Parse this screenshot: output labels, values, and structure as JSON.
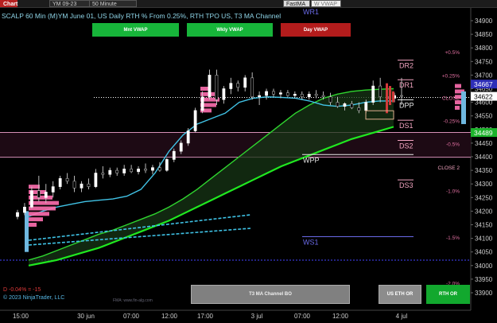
{
  "toolbar": {
    "chart_label": "Chart",
    "symbol": "YM 09-23",
    "interval": "50 Minute",
    "fasma_label": "FastMA",
    "wvwap_label": "W VWAP"
  },
  "title": "SCALP 60 Min (M)YM June 01, US Daily RTH % From 0.25%, RTH TPO US, T3 MA Channel",
  "buttons": {
    "monthly_vwap": "Mnt VWAP",
    "weekly_vwap": "Wkly VWAP",
    "day_vwap": "Day VWAP",
    "t3_channel": "T3 MA Channel BO",
    "us_eth": "US ETH OR",
    "rth_or": "RTH OR"
  },
  "pnl_text": "D -0.04% = -15",
  "copyright": "© 2023 NinjaTrader, LLC",
  "watermark": "FMA: www.fin-alg.com",
  "colors": {
    "background": "#000000",
    "bullish_candle": "#ffffff",
    "bearish_candle": "#000000",
    "up_bar_highlight": "#9ea6ad",
    "tpo_profile": "#ff6fb0",
    "value_band": "#1d0a14",
    "ma_fast": "#2fd52f",
    "ma_slow": "#20e820",
    "vwap_line": "#41c3e6",
    "level_label_pink": "#f2a4c0",
    "level_label_white": "#e8e8e8",
    "level_line_blue": "#6a6ae8",
    "accent_red": "#d23a3a"
  },
  "chart_data": {
    "type": "candlestick",
    "y_axis": {
      "ticks": [
        34900,
        34850,
        34800,
        34750,
        34700,
        34650,
        34600,
        34550,
        34500,
        34450,
        34400,
        34350,
        34300,
        34250,
        34200,
        34150,
        34100,
        34050,
        34000,
        33950,
        33900
      ],
      "range": [
        33875,
        34925
      ],
      "position": "right"
    },
    "x_axis": {
      "ticks": [
        "15:00",
        "30 jun",
        "07:00",
        "12:00",
        "17:00",
        "3 jul",
        "07:00",
        "12:00",
        "4 jul"
      ]
    },
    "price_markers": [
      {
        "value": 34667,
        "label": "34667",
        "style": "blue"
      },
      {
        "value": 34622,
        "label": "34622",
        "style": "white"
      },
      {
        "value": 34489,
        "label": "34489",
        "style": "green"
      }
    ],
    "levels": [
      {
        "name": "WR1",
        "value": 34930,
        "color": "#6a6ae8"
      },
      {
        "name": "DR2",
        "value": 34755,
        "color": "#f2a4c0"
      },
      {
        "name": "DR1",
        "value": 34683,
        "color": "#f2a4c0"
      },
      {
        "name": "DPP",
        "value": 34609,
        "color": "#e8e8e8"
      },
      {
        "name": "DS1",
        "value": 34534,
        "color": "#f2a4c0"
      },
      {
        "name": "DS2",
        "value": 34460,
        "color": "#f2a4c0"
      },
      {
        "name": "WPP",
        "value": 34408,
        "color": "#e8e8e8"
      },
      {
        "name": "DS3",
        "value": 34315,
        "color": "#f2a4c0"
      },
      {
        "name": "WS1",
        "value": 34106,
        "color": "#6a6ae8"
      }
    ],
    "value_area": {
      "high": 34489,
      "low": 34398
    },
    "percent_labels": [
      {
        "label": "+0.5%",
        "value": 34786
      },
      {
        "label": "+0.25%",
        "value": 34700
      },
      {
        "label": "CLOSE",
        "value": 34618
      },
      {
        "label": "-0.25%",
        "value": 34533
      },
      {
        "label": "-0.5%",
        "value": 34448
      },
      {
        "label": "CLOSE 2",
        "value": 34362
      },
      {
        "label": "-1.0%",
        "value": 34276
      },
      {
        "label": "-1.5%",
        "value": 34105
      },
      {
        "label": "-2.0%",
        "value": 33936
      }
    ],
    "candles": [
      {
        "o": 34180,
        "h": 34205,
        "l": 34170,
        "c": 34195
      },
      {
        "o": 34195,
        "h": 34230,
        "l": 34185,
        "c": 34215
      },
      {
        "o": 34215,
        "h": 34290,
        "l": 34210,
        "c": 34275
      },
      {
        "o": 34275,
        "h": 34330,
        "l": 34235,
        "c": 34250
      },
      {
        "o": 34250,
        "h": 34300,
        "l": 34230,
        "c": 34270
      },
      {
        "o": 34270,
        "h": 34310,
        "l": 34250,
        "c": 34290
      },
      {
        "o": 34290,
        "h": 34330,
        "l": 34280,
        "c": 34320
      },
      {
        "o": 34320,
        "h": 34340,
        "l": 34300,
        "c": 34310
      },
      {
        "o": 34310,
        "h": 34330,
        "l": 34270,
        "c": 34285
      },
      {
        "o": 34285,
        "h": 34310,
        "l": 34270,
        "c": 34300
      },
      {
        "o": 34300,
        "h": 34320,
        "l": 34280,
        "c": 34290
      },
      {
        "o": 34290,
        "h": 34355,
        "l": 34285,
        "c": 34340
      },
      {
        "o": 34340,
        "h": 34365,
        "l": 34320,
        "c": 34335
      },
      {
        "o": 34335,
        "h": 34360,
        "l": 34325,
        "c": 34350
      },
      {
        "o": 34350,
        "h": 34360,
        "l": 34330,
        "c": 34340
      },
      {
        "o": 34340,
        "h": 34370,
        "l": 34330,
        "c": 34355
      },
      {
        "o": 34355,
        "h": 34370,
        "l": 34340,
        "c": 34345
      },
      {
        "o": 34345,
        "h": 34365,
        "l": 34335,
        "c": 34355
      },
      {
        "o": 34355,
        "h": 34375,
        "l": 34340,
        "c": 34350
      },
      {
        "o": 34350,
        "h": 34370,
        "l": 34335,
        "c": 34360
      },
      {
        "o": 34360,
        "h": 34380,
        "l": 34345,
        "c": 34350
      },
      {
        "o": 34350,
        "h": 34395,
        "l": 34345,
        "c": 34390
      },
      {
        "o": 34390,
        "h": 34430,
        "l": 34380,
        "c": 34420
      },
      {
        "o": 34420,
        "h": 34460,
        "l": 34410,
        "c": 34450
      },
      {
        "o": 34450,
        "h": 34505,
        "l": 34440,
        "c": 34495
      },
      {
        "o": 34495,
        "h": 34580,
        "l": 34490,
        "c": 34570
      },
      {
        "o": 34570,
        "h": 34640,
        "l": 34560,
        "c": 34620
      },
      {
        "o": 34620,
        "h": 34720,
        "l": 34610,
        "c": 34700
      },
      {
        "o": 34700,
        "h": 34720,
        "l": 34590,
        "c": 34610
      },
      {
        "o": 34610,
        "h": 34660,
        "l": 34595,
        "c": 34650
      },
      {
        "o": 34650,
        "h": 34690,
        "l": 34630,
        "c": 34670
      },
      {
        "o": 34670,
        "h": 34680,
        "l": 34640,
        "c": 34655
      },
      {
        "o": 34655,
        "h": 34700,
        "l": 34640,
        "c": 34690
      },
      {
        "o": 34690,
        "h": 34710,
        "l": 34610,
        "c": 34620
      },
      {
        "o": 34620,
        "h": 34640,
        "l": 34590,
        "c": 34625
      },
      {
        "o": 34625,
        "h": 34650,
        "l": 34610,
        "c": 34640
      },
      {
        "o": 34640,
        "h": 34650,
        "l": 34620,
        "c": 34630
      },
      {
        "o": 34630,
        "h": 34645,
        "l": 34615,
        "c": 34635
      },
      {
        "o": 34635,
        "h": 34645,
        "l": 34620,
        "c": 34625
      },
      {
        "o": 34625,
        "h": 34640,
        "l": 34615,
        "c": 34630
      },
      {
        "o": 34630,
        "h": 34640,
        "l": 34610,
        "c": 34620
      },
      {
        "o": 34620,
        "h": 34640,
        "l": 34610,
        "c": 34630
      },
      {
        "o": 34630,
        "h": 34645,
        "l": 34615,
        "c": 34625
      },
      {
        "o": 34625,
        "h": 34640,
        "l": 34610,
        "c": 34620
      },
      {
        "o": 34620,
        "h": 34635,
        "l": 34590,
        "c": 34600
      },
      {
        "o": 34600,
        "h": 34620,
        "l": 34580,
        "c": 34585
      },
      {
        "o": 34585,
        "h": 34600,
        "l": 34570,
        "c": 34595
      },
      {
        "o": 34595,
        "h": 34605,
        "l": 34575,
        "c": 34580
      },
      {
        "o": 34580,
        "h": 34600,
        "l": 34560,
        "c": 34570
      },
      {
        "o": 34570,
        "h": 34610,
        "l": 34560,
        "c": 34600
      },
      {
        "o": 34600,
        "h": 34680,
        "l": 34590,
        "c": 34660
      },
      {
        "o": 34660,
        "h": 34690,
        "l": 34600,
        "c": 34620
      },
      {
        "o": 34620,
        "h": 34640,
        "l": 34605,
        "c": 34615
      },
      {
        "o": 34615,
        "h": 34635,
        "l": 34600,
        "c": 34625
      },
      {
        "o": 34625,
        "h": 34690,
        "l": 34590,
        "c": 34622
      }
    ],
    "series": [
      {
        "name": "T3 fast",
        "values": [
          34020,
          34035,
          34055,
          34075,
          34095,
          34115,
          34130,
          34150,
          34170,
          34190,
          34215,
          34245,
          34280,
          34320,
          34360,
          34400,
          34440,
          34480,
          34520,
          34560,
          34590,
          34615,
          34630,
          34640,
          34645,
          34648,
          34650
        ]
      },
      {
        "name": "T3 slow",
        "values": [
          34000,
          34010,
          34020,
          34035,
          34050,
          34065,
          34085,
          34105,
          34125,
          34145,
          34165,
          34190,
          34215,
          34240,
          34265,
          34290,
          34315,
          34340,
          34365,
          34385,
          34405,
          34425,
          34445,
          34465,
          34480,
          34495,
          34510
        ]
      },
      {
        "name": "VWAP",
        "values": [
          34180,
          34200,
          34215,
          34225,
          34235,
          34240,
          34245,
          34255,
          34280,
          34340,
          34420,
          34480,
          34520,
          34540,
          34560,
          34600,
          34615,
          34620,
          34618,
          34615,
          34605,
          34590,
          34585,
          34590,
          34600,
          34605,
          34605
        ]
      }
    ]
  }
}
